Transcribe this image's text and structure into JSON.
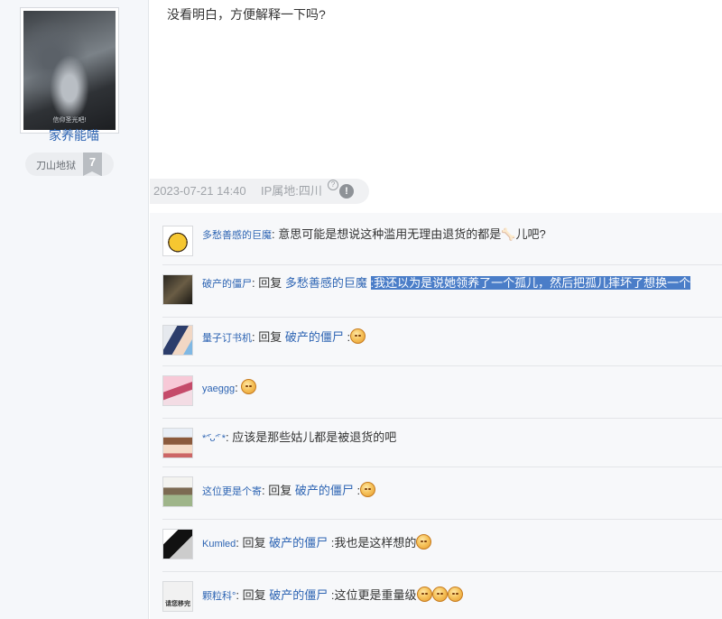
{
  "author": {
    "name": "家养能喵",
    "level_title": "刀山地狱",
    "level": "7",
    "avatar_caption": "信仰圣光吧!"
  },
  "post": {
    "text": "没看明白，方便解释一下吗?",
    "date": "2023-07-21 14:40",
    "ip": "IP属地:四川",
    "help_glyph": "?",
    "report_glyph": "!"
  },
  "comments": [
    {
      "user": "多愁善感的巨魔",
      "sep": ": ",
      "text": "意思可能是想说这种滥用无理由退货的都是",
      "trail": "儿吧?",
      "avatar": "bee-avatar"
    },
    {
      "user": "破产的僵尸",
      "sep": ": ",
      "reply_word": "回复 ",
      "reply_to": "多愁善感的巨魔",
      "text": ":我还以为是说她领养了一个孤儿，然后把孤儿摔坏了想换一个",
      "avatar": "dark-avatar"
    },
    {
      "user": "量子订书机",
      "sep": ": ",
      "reply_word": "回复 ",
      "reply_to": "破产的僵尸",
      "text": " :",
      "emoji_count": 1,
      "avatar": "anime-avatar"
    },
    {
      "user": "yaeggg",
      "sep": ": ",
      "emoji_count": 1,
      "avatar": "anime-avatar"
    },
    {
      "user": "*ᵔ᷄ᴗᵔ᷅ *",
      "sep": ": ",
      "text": "应该是那些姑儿都是被退货的吧",
      "avatar": "anime-avatar"
    },
    {
      "user": "这位更是个寄",
      "sep": ": ",
      "reply_word": "回复 ",
      "reply_to": "破产的僵尸",
      "text": " :",
      "emoji_count": 1,
      "avatar": "anime-avatar"
    },
    {
      "user": "Kumled",
      "sep": ": ",
      "reply_word": "回复 ",
      "reply_to": "破产的僵尸",
      "text": " :我也是这样想的",
      "emoji_count": 1,
      "avatar": "bw-avatar"
    },
    {
      "user": "颗粒科°",
      "sep": ": ",
      "reply_word": "回复 ",
      "reply_to": "破产的僵尸",
      "text": " :这位更是重量级",
      "emoji_count": 3,
      "avatar": "text-avatar",
      "avatar_text": "请您移完"
    }
  ],
  "colors": {
    "link": "#2d64b3",
    "highlight": "#4a7dc8"
  }
}
